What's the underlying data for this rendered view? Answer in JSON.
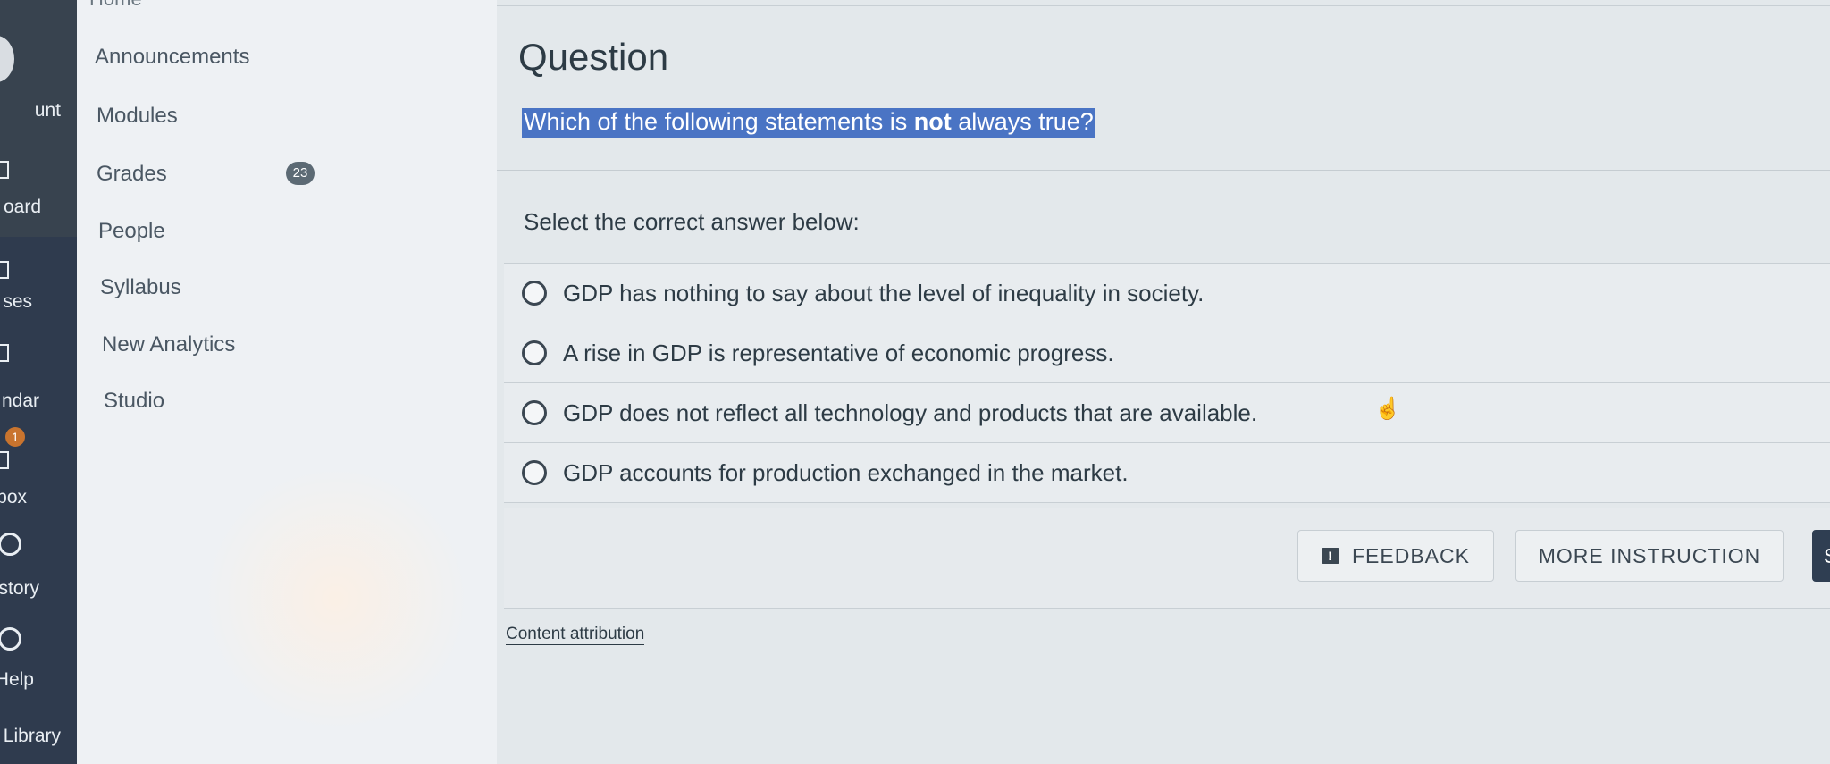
{
  "global_nav": {
    "items": [
      {
        "label": "unt",
        "icon": "user-icon"
      },
      {
        "label": "oard",
        "icon": "dashboard-icon"
      },
      {
        "label": "ses",
        "icon": "courses-icon"
      },
      {
        "label": "ndar",
        "icon": "calendar-icon"
      },
      {
        "label": "box",
        "icon": "inbox-icon"
      },
      {
        "label": "story",
        "icon": "history-icon"
      },
      {
        "label": "Help",
        "icon": "help-icon"
      },
      {
        "label": "Library",
        "icon": "library-icon"
      }
    ],
    "inbox_badge": "1"
  },
  "course_nav": {
    "home": "Home",
    "items": [
      {
        "label": "Announcements"
      },
      {
        "label": "Modules"
      },
      {
        "label": "Grades"
      },
      {
        "label": "People"
      },
      {
        "label": "Syllabus"
      },
      {
        "label": "New Analytics"
      },
      {
        "label": "Studio"
      }
    ],
    "grades_badge": "23"
  },
  "question": {
    "heading": "Question",
    "text_before": "Which of the following statements is ",
    "text_emphasis": "not",
    "text_after": " always true?",
    "prompt": "Select the correct answer below:",
    "answers": [
      {
        "label": "GDP has nothing to say about the level of inequality in society."
      },
      {
        "label": "A rise in GDP is representative of economic progress."
      },
      {
        "label": "GDP does not reflect all technology and products that are available."
      },
      {
        "label": "GDP accounts for production exchanged in the market."
      }
    ]
  },
  "actions": {
    "feedback_label": "FEEDBACK",
    "more_instruction_label": "MORE INSTRUCTION",
    "submit_label": "S"
  },
  "footer": {
    "attribution": "Content attribution"
  },
  "colors": {
    "highlight": "#4a74c4",
    "nav_dark": "#2f3b4e",
    "submit_bg": "#2f3e52"
  }
}
